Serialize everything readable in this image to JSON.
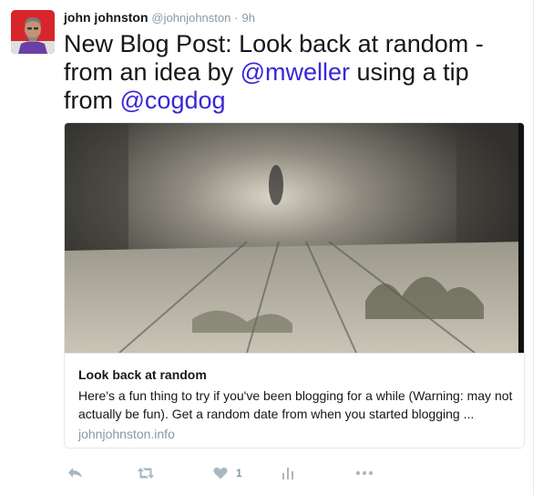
{
  "author": {
    "name": "john johnston",
    "handle": "@johnjohnston",
    "separator": "·",
    "time": "9h"
  },
  "tweet": {
    "text_before": "New Blog Post: Look back at random - from an idea by ",
    "mention_1": "@mweller",
    "text_middle": " using a tip from ",
    "mention_2": "@cogdog"
  },
  "card": {
    "title": "Look back at random",
    "description": "Here's a fun thing to try if you've been blogging for a while (Warning: may not actually be fun). Get a random date from when you started blogging ...",
    "domain": "johnjohnston.info"
  },
  "actions": {
    "like_count": "1"
  },
  "icons": {
    "reply": "reply-icon",
    "retweet": "retweet-icon",
    "like": "heart-icon",
    "analytics": "analytics-icon",
    "more": "more-icon"
  },
  "colors": {
    "mention": "#3b26d6",
    "muted": "#8899a6",
    "action_icon": "#aab8c2",
    "avatar_bg": "#d7262b"
  }
}
